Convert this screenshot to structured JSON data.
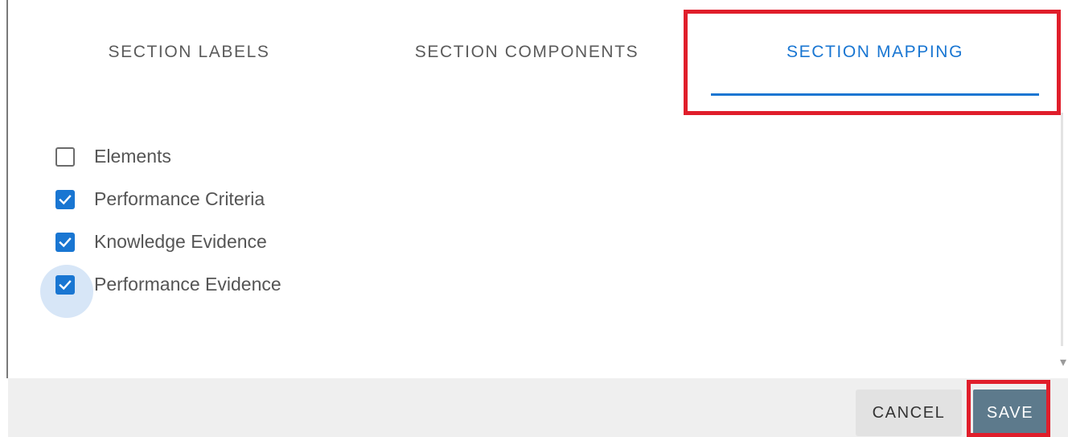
{
  "tabs": [
    {
      "label": "SECTION LABELS",
      "active": false
    },
    {
      "label": "SECTION COMPONENTS",
      "active": false
    },
    {
      "label": "SECTION MAPPING",
      "active": true
    }
  ],
  "options": [
    {
      "label": "Elements",
      "checked": false
    },
    {
      "label": "Performance Criteria",
      "checked": true
    },
    {
      "label": "Knowledge Evidence",
      "checked": true
    },
    {
      "label": "Performance Evidence",
      "checked": true,
      "focused": true
    }
  ],
  "footer": {
    "cancel_label": "CANCEL",
    "save_label": "SAVE"
  },
  "colors": {
    "accent": "#1976d2",
    "save_button": "#5d7a8c",
    "highlight": "#e01e2b"
  },
  "icons": {
    "checkmark": "check-icon",
    "scroll": "scroll-down-arrow-icon"
  }
}
